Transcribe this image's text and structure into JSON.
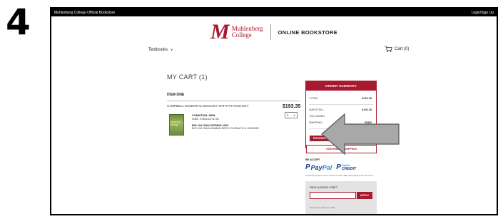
{
  "step_number": "4",
  "topbar": {
    "site_name": "Muhlenberg College Official Bookstore",
    "login_label": "Login/Sign Up"
  },
  "brand": {
    "logo_mark": "M",
    "name_line1": "Muhlenberg",
    "name_line2": "College",
    "store_label": "ONLINE BOOKSTORE",
    "accent_color": "#a6192e"
  },
  "nav": {
    "textbooks_label": "Textbooks",
    "textbooks_chevron": "∨",
    "cart_label": "Cart (0)",
    "cart_icon": "cart-icon"
  },
  "cart": {
    "page_title": "MY CART (1)",
    "item_header": "ITEM ONE",
    "product_title": "CAMPBELL ESSENTIAL BIOLOGY WITH PHYSIOLOGY",
    "price": "$193.35",
    "quantity": "1",
    "cover_text": "essential biology",
    "condition": "CONDITION: NEW",
    "isbn": "ISBN: 9780134711751",
    "course_line1": "BIO 104 ONLN SPRING 2020",
    "course_line2": "BIO 104 ONLN HUMAN BODY IN HEALTH & DISEASE"
  },
  "summary": {
    "header": "ORDER SUMMARY",
    "items_label": "1 ITEM",
    "items_value": "$193.35",
    "subtotal_label": "SUBTOTAL:",
    "subtotal_value": "$193.35",
    "saved_label": "YOU SAVED:",
    "saved_value": "",
    "shipping_label": "SHIPPING:",
    "shipping_value": "FREE",
    "checkout_label": "PROCEED TO CHECKOUT",
    "continue_label": "CONTINUE SHOPPING"
  },
  "payment": {
    "accept_label": "WE ACCEPT",
    "paypal_mark": "P",
    "paypal_word_1": "Pay",
    "paypal_word_2": "Pal",
    "paypal_credit_1": "PayPal",
    "paypal_credit_2": "CREDIT",
    "note": "No Interest if paid in full in 6 months on orders $99+ with PayPal Credit. See terms."
  },
  "promo": {
    "question": "Have a promo code?",
    "input_value": "",
    "apply_label": "APPLY",
    "note": "One promo code per order."
  },
  "annotation": {
    "arrow_color": "#a8a8a8"
  }
}
